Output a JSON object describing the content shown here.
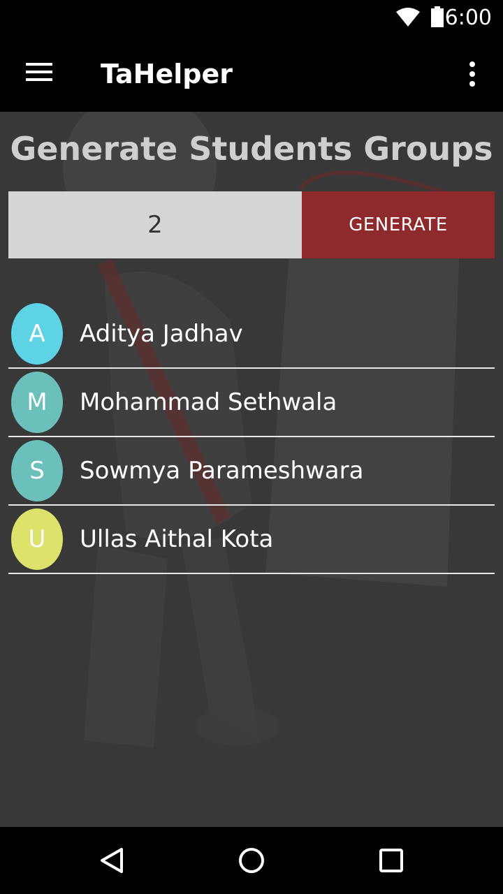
{
  "status_bar": {
    "time": "6:00",
    "icons": [
      "wifi-icon",
      "battery-icon"
    ]
  },
  "app_bar": {
    "title": "TaHelper",
    "icons": [
      "menu-icon",
      "overflow-menu-icon"
    ]
  },
  "main": {
    "heading": "Generate Students Groups",
    "group_count_value": "2",
    "generate_label": "GENERATE",
    "students": [
      {
        "initial": "A",
        "name": "Aditya Jadhav",
        "color": "#5fd3e6"
      },
      {
        "initial": "M",
        "name": "Mohammad Sethwala",
        "color": "#6cc0bb"
      },
      {
        "initial": "S",
        "name": "Sowmya Parameshwara",
        "color": "#6cc0bb"
      },
      {
        "initial": "U",
        "name": "Ullas Aithal Kota",
        "color": "#dde36a"
      }
    ]
  },
  "nav_bar": {
    "icons": [
      "back-icon",
      "home-icon",
      "recents-icon"
    ]
  },
  "colors": {
    "accent": "#8e2a2c",
    "background": "#383838"
  }
}
